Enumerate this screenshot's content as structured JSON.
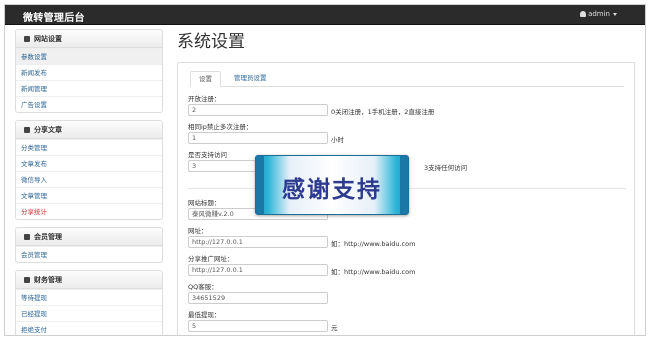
{
  "topbar": {
    "brand": "微转管理后台",
    "user": "admin"
  },
  "sidebar": {
    "groups": [
      {
        "title": "网站设置",
        "items": [
          "参数设置",
          "新闻发布",
          "新闻管理",
          "广告设置"
        ]
      },
      {
        "title": "分享文章",
        "items": [
          "分类管理",
          "文章发布",
          "微信导入",
          "文章管理",
          "分享统计"
        ]
      },
      {
        "title": "会员管理",
        "items": [
          "会员管理"
        ]
      },
      {
        "title": "财务管理",
        "items": [
          "等待提现",
          "已经提现",
          "拒绝支付"
        ]
      }
    ]
  },
  "main": {
    "title": "系统设置",
    "tabs": [
      "设置",
      "管理员设置"
    ],
    "fields": [
      {
        "label": "开放注册：",
        "value": "2",
        "help": "0关闭注册，1手机注册，2直接注册"
      },
      {
        "label": "相同ip禁止多次注册：",
        "value": "1",
        "help": "小时"
      },
      {
        "label": "是否支持访问",
        "value": "3",
        "help": "3支持任何访问"
      },
      {
        "label": "网站标题：",
        "value": "泰风微赚v.2.0",
        "help": ""
      },
      {
        "label": "网址：",
        "value": "http://127.0.0.1",
        "help": "如：http://www.baidu.com"
      },
      {
        "label": "分享推广网址：",
        "value": "http://127.0.0.1",
        "help": "如：http://www.baidu.com"
      },
      {
        "label": "QQ客服：",
        "value": "34651529",
        "help": ""
      },
      {
        "label": "最低提现：",
        "value": "5",
        "help": "元"
      }
    ]
  },
  "overlay": {
    "text": "感谢支持"
  },
  "colors": {
    "topbar": "#2b2b2b",
    "link": "#2a6496",
    "active_red": "#c9302c",
    "overlay_text": "#2c3a8f"
  }
}
